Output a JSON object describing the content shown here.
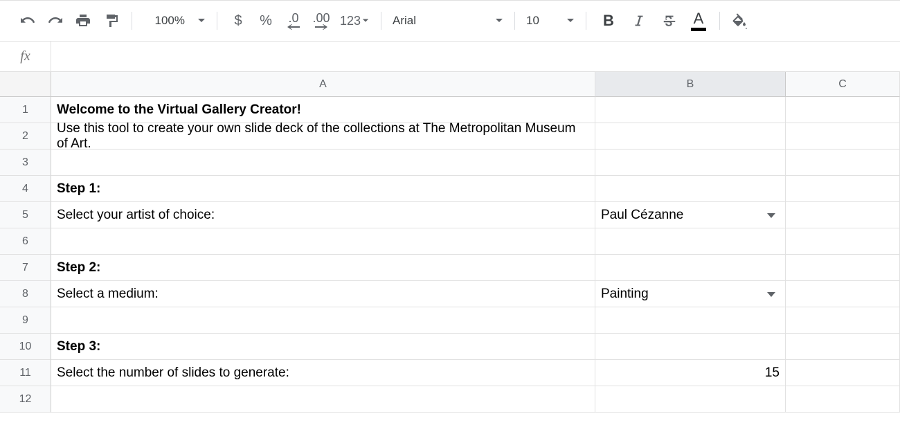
{
  "toolbar": {
    "zoom": "100%",
    "font_name": "Arial",
    "font_size": "10",
    "decrease_decimal": ".0",
    "increase_decimal": ".00",
    "more_formats": "123",
    "currency": "$",
    "percent": "%",
    "bold": "B",
    "textcolor_letter": "A"
  },
  "formula_bar": {
    "fx": "fx",
    "value": ""
  },
  "columns": {
    "A": "A",
    "B": "B",
    "C": "C"
  },
  "rows": [
    "1",
    "2",
    "3",
    "4",
    "5",
    "6",
    "7",
    "8",
    "9",
    "10",
    "11",
    "12"
  ],
  "cells": {
    "r1": {
      "A": "Welcome to the Virtual Gallery Creator!"
    },
    "r2": {
      "A": "Use this tool to create your own slide deck of the collections at The Metropolitan Museum of Art."
    },
    "r4": {
      "A": "Step 1:"
    },
    "r5": {
      "A": "Select your artist of choice:",
      "B": "Paul Cézanne"
    },
    "r7": {
      "A": "Step 2:"
    },
    "r8": {
      "A": "Select a medium:",
      "B": "Painting"
    },
    "r10": {
      "A": "Step 3:"
    },
    "r11": {
      "A": "Select the number of slides to generate:",
      "B": "15"
    }
  }
}
